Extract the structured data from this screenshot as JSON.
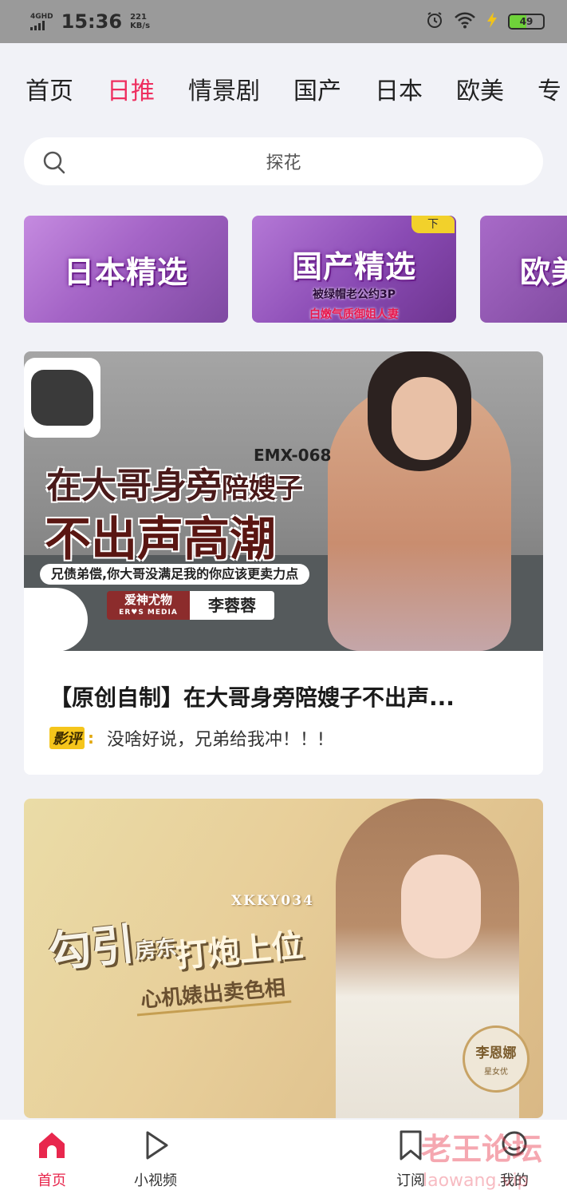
{
  "status_bar": {
    "network_label": "4GHD",
    "time": "15:36",
    "speed_value": "221",
    "speed_unit": "KB/s",
    "battery": "49",
    "battery_level_percent": 49,
    "icons": [
      "signal-icon",
      "alarm-icon",
      "wifi-icon",
      "charging-icon",
      "battery-icon"
    ]
  },
  "tabs": [
    {
      "label": "首页",
      "active": false
    },
    {
      "label": "日推",
      "active": true
    },
    {
      "label": "情景剧",
      "active": false
    },
    {
      "label": "国产",
      "active": false
    },
    {
      "label": "日本",
      "active": false
    },
    {
      "label": "欧美",
      "active": false
    },
    {
      "label": "专",
      "active": false
    }
  ],
  "search": {
    "placeholder": "探花",
    "icon": "search-icon"
  },
  "promos": [
    {
      "title": "日本精选"
    },
    {
      "title": "国产精选",
      "tag": "下",
      "line1": "被绿帽老公约3P",
      "line2": "白嫩气质御姐人妻"
    },
    {
      "title": "欧美"
    }
  ],
  "videos": [
    {
      "thumb": {
        "code": "EMX-068",
        "headline_part1": "在大哥身旁",
        "headline_part2": "陪嫂子",
        "headline_big": "不出声高潮",
        "tagline": "兄债弟偿,你大哥没满足我的你应该更卖力点",
        "studio": "爱神尤物",
        "studio_en": "ER♥S MEDIA",
        "actress": "李蓉蓉"
      },
      "title": "【原创自制】在大哥身旁陪嫂子不出声...",
      "review_badge": "影评",
      "review_colon": ":",
      "review_text": "没啥好说，兄弟给我冲！！!"
    },
    {
      "thumb": {
        "code": "XKKY034",
        "headline_a": "勾引",
        "headline_a_small": "房东",
        "headline_b": "打炮上位",
        "headline_c": "心机婊出卖色相",
        "actress": "李恩娜",
        "actress_role": "星女优"
      }
    }
  ],
  "bottom_nav": [
    {
      "label": "首页",
      "icon": "home-icon",
      "active": true
    },
    {
      "label": "小视频",
      "icon": "play-icon",
      "active": false
    },
    {
      "label": "订阅",
      "icon": "bookmark-icon",
      "active": false
    },
    {
      "label": "我的",
      "icon": "user-icon",
      "active": false
    }
  ],
  "watermark": {
    "text": "老王论坛",
    "url": "laowang.vip"
  },
  "colors": {
    "accent": "#ee2e5f",
    "status_bar": "#9a9a9a",
    "page_bg": "#f1f2f7",
    "review_badge": "#f5c51b"
  }
}
